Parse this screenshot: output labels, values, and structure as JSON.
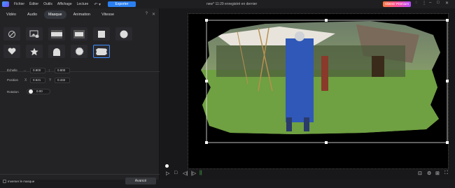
{
  "menubar": {
    "items": [
      "Fichier",
      "Éditer",
      "Outils",
      "Affichage",
      "Lecture"
    ],
    "undo_icon": "undo-icon",
    "export_label": "Exporter",
    "project_title": "new* 11:29 enregistré en dernier",
    "premium_label": "Obtenir Premium",
    "accent_color": "#2b7ff0"
  },
  "panel": {
    "tabs": [
      "Vidéo",
      "Audio",
      "Masque",
      "Animation",
      "Vitesse"
    ],
    "active_tab": "Masque",
    "shapes": [
      "none-icon",
      "image-icon",
      "horizontal-band-icon",
      "rectangle-band-icon",
      "square-icon",
      "circle-icon",
      "heart-icon",
      "star-icon",
      "arch-icon",
      "badge-icon",
      "brush-stroke-icon"
    ],
    "selected_shape": "brush-stroke-icon",
    "scale_label": "Échelle",
    "scale_w": "0.800",
    "scale_h": "0.800",
    "position_label": "Position",
    "pos_x_label": "X",
    "pos_x": "0.521",
    "pos_y_label": "Y",
    "pos_y": "0.432",
    "rotation_label": "Rotation",
    "rotation": "0.00",
    "invert_label": "Inverser le masque",
    "advanced_label": "Avancé"
  },
  "preview": {
    "controls": [
      "play-icon",
      "stop-icon",
      "prev-frame-icon",
      "next-frame-icon",
      "split-icon"
    ]
  }
}
